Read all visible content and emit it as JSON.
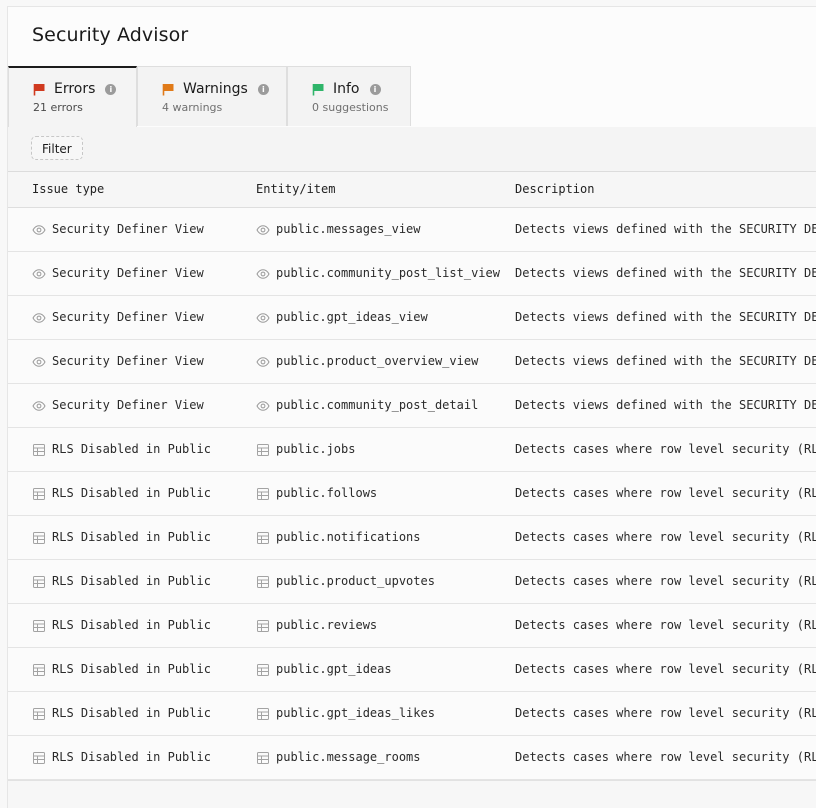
{
  "page": {
    "title": "Security Advisor"
  },
  "tabs": [
    {
      "label": "Errors",
      "sub": "21 errors",
      "color": "#d03a1f",
      "active": true
    },
    {
      "label": "Warnings",
      "sub": "4 warnings",
      "color": "#e07a18",
      "active": false
    },
    {
      "label": "Info",
      "sub": "0 suggestions",
      "color": "#2fb56a",
      "active": false
    }
  ],
  "filter": {
    "label": "Filter"
  },
  "table": {
    "columns": [
      "Issue type",
      "Entity/item",
      "Description"
    ],
    "rows": [
      {
        "type": "Security Definer View",
        "icon": "eye-icon",
        "entity": "public.messages_view",
        "description": "Detects views defined with the SECURITY DEFINER"
      },
      {
        "type": "Security Definer View",
        "icon": "eye-icon",
        "entity": "public.community_post_list_view",
        "description": "Detects views defined with the SECURITY DEFINER"
      },
      {
        "type": "Security Definer View",
        "icon": "eye-icon",
        "entity": "public.gpt_ideas_view",
        "description": "Detects views defined with the SECURITY DEFINER"
      },
      {
        "type": "Security Definer View",
        "icon": "eye-icon",
        "entity": "public.product_overview_view",
        "description": "Detects views defined with the SECURITY DEFINER"
      },
      {
        "type": "Security Definer View",
        "icon": "eye-icon",
        "entity": "public.community_post_detail",
        "description": "Detects views defined with the SECURITY DEFINER"
      },
      {
        "type": "RLS Disabled in Public",
        "icon": "table-icon",
        "entity": "public.jobs",
        "description": "Detects cases where row level security (RLS)"
      },
      {
        "type": "RLS Disabled in Public",
        "icon": "table-icon",
        "entity": "public.follows",
        "description": "Detects cases where row level security (RLS)"
      },
      {
        "type": "RLS Disabled in Public",
        "icon": "table-icon",
        "entity": "public.notifications",
        "description": "Detects cases where row level security (RLS)"
      },
      {
        "type": "RLS Disabled in Public",
        "icon": "table-icon",
        "entity": "public.product_upvotes",
        "description": "Detects cases where row level security (RLS)"
      },
      {
        "type": "RLS Disabled in Public",
        "icon": "table-icon",
        "entity": "public.reviews",
        "description": "Detects cases where row level security (RLS)"
      },
      {
        "type": "RLS Disabled in Public",
        "icon": "table-icon",
        "entity": "public.gpt_ideas",
        "description": "Detects cases where row level security (RLS)"
      },
      {
        "type": "RLS Disabled in Public",
        "icon": "table-icon",
        "entity": "public.gpt_ideas_likes",
        "description": "Detects cases where row level security (RLS)"
      },
      {
        "type": "RLS Disabled in Public",
        "icon": "table-icon",
        "entity": "public.message_rooms",
        "description": "Detects cases where row level security (RLS)"
      }
    ]
  }
}
